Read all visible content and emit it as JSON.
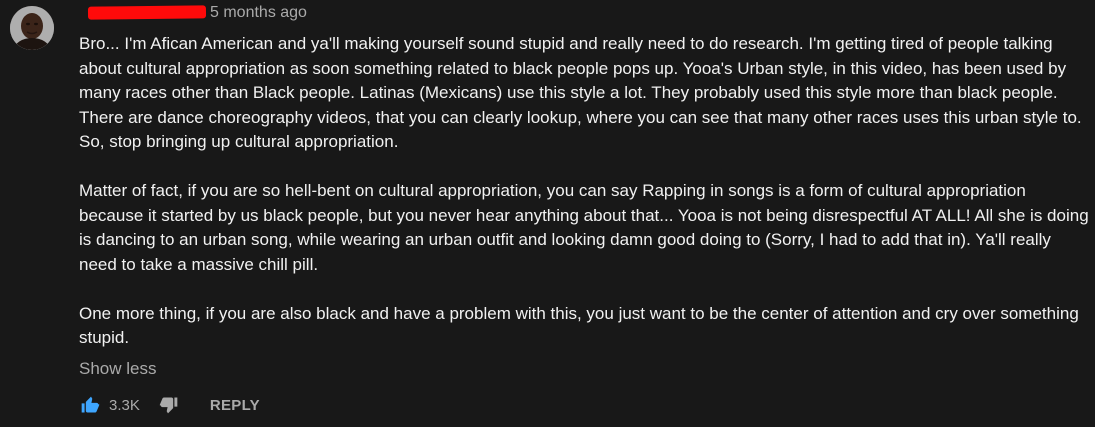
{
  "comment": {
    "author": "",
    "timestamp": "5 months ago",
    "paragraphs": [
      "Bro... I'm Afican American and ya'll making yourself sound stupid and really need to do research. I'm getting tired of people talking about cultural appropriation as soon something related to black people pops up. Yooa's Urban style, in this video, has been used by many races other than Black people. Latinas (Mexicans) use this style a lot. They probably used this style more than black people. There are dance choreography videos, that you can clearly lookup, where you can see that many other races uses this urban style to. So, stop bringing up cultural appropriation.",
      "Matter of fact, if you are so hell-bent on cultural appropriation, you can say Rapping in songs is a form of cultural appropriation because it started by us black people, but you never hear anything about that... Yooa is not being disrespectful AT ALL! All she is doing is dancing to an urban song, while wearing an urban outfit and looking damn good doing to (Sorry, I had to add that in). Ya'll really need to take a massive chill pill.",
      "One more thing, if you are also black and have a problem with this, you just want to be the center of attention and cry over something stupid."
    ],
    "show_less_label": "Show less",
    "like_count": "3.3K",
    "reply_label": "REPLY"
  },
  "icons": {
    "like": "thumbs-up-icon",
    "dislike": "thumbs-down-icon"
  },
  "colors": {
    "background": "#181818",
    "text": "#f1f1f1",
    "secondary_text": "#aaaaaa",
    "like_active": "#3ea6ff",
    "redaction": "#ff0a0a"
  }
}
